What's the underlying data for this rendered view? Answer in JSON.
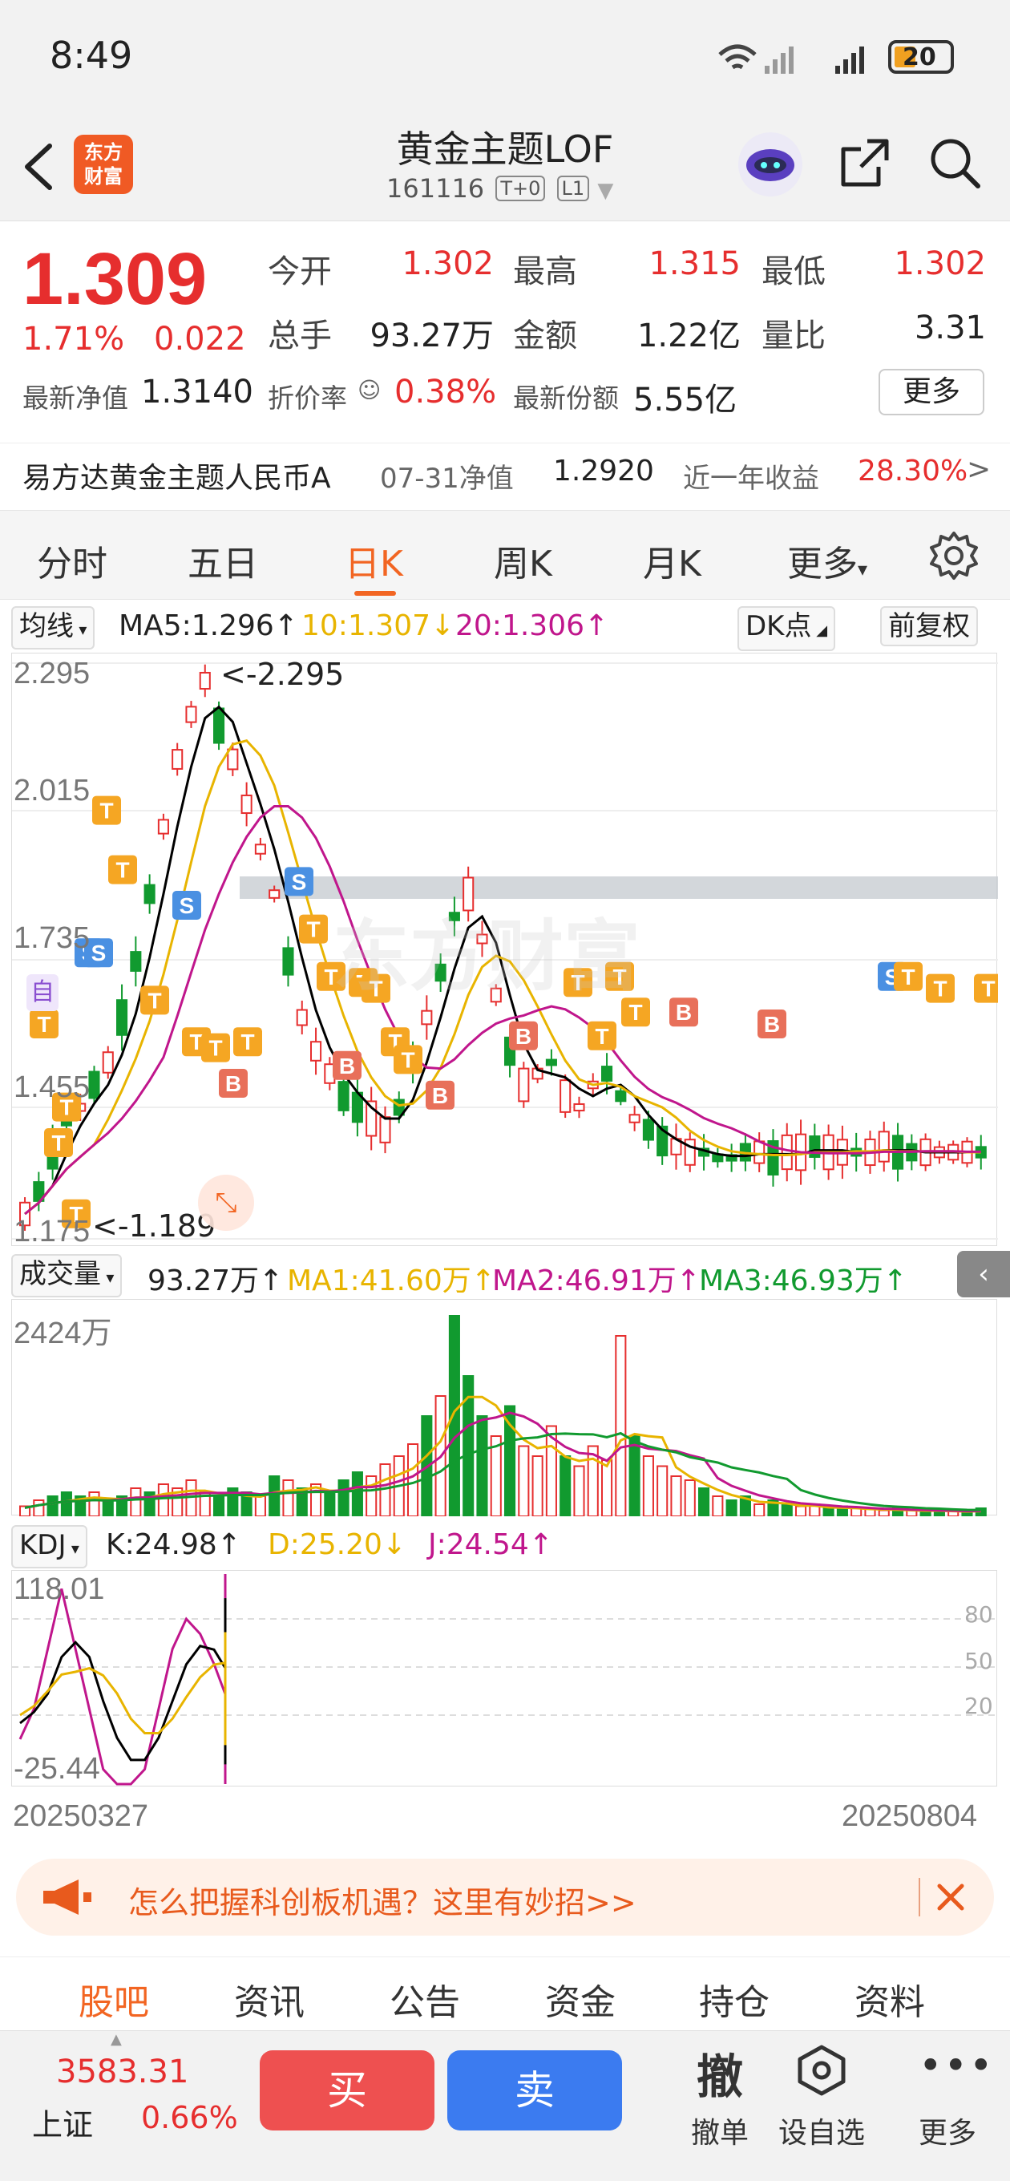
{
  "status_bar": {
    "time": "8:49",
    "battery": "20"
  },
  "header": {
    "logo_line1": "东方",
    "logo_line2": "财富",
    "title": "黄金主题LOF",
    "code": "161116",
    "tag1": "T+0",
    "tag2": "L1"
  },
  "quote": {
    "price": "1.309",
    "change_pct": "1.71%",
    "change": "0.022",
    "open_label": "今开",
    "open": "1.302",
    "high_label": "最高",
    "high": "1.315",
    "low_label": "最低",
    "low": "1.302",
    "volume_label": "总手",
    "volume": "93.27万",
    "amount_label": "金额",
    "amount": "1.22亿",
    "ratio_label": "量比",
    "ratio": "3.31",
    "nav_label": "最新净值",
    "nav": "1.3140",
    "discount_label": "折价率",
    "discount": "0.38%",
    "shares_label": "最新份额",
    "shares": "5.55亿",
    "more": "更多"
  },
  "fund_row": {
    "name": "易方达黄金主题人民币A",
    "nav_label": "07-31净值",
    "nav": "1.2920",
    "return_label": "近一年收益",
    "return": "28.30%"
  },
  "tabs": [
    "分时",
    "五日",
    "日K",
    "周K",
    "月K",
    "更多"
  ],
  "chart": {
    "indicator_select": "均线",
    "ma5": "MA5:1.296↑",
    "ma10": "10:1.307↓",
    "ma20": "20:1.306↑",
    "dk_button": "DK点",
    "adjust_button": "前复权",
    "y_labels": [
      "2.295",
      "2.015",
      "1.735",
      "1.455",
      "1.175"
    ],
    "high_marker": "<-2.295",
    "low_marker": "<-1.189",
    "watermark": "东方财富",
    "auto_tag": "自"
  },
  "volume": {
    "select": "成交量",
    "value": "93.27万↑",
    "ma1": "MA1:41.60万↑",
    "ma2": "MA2:46.91万↑",
    "ma3": "MA3:46.93万↑",
    "max_label": "2424万"
  },
  "kdj": {
    "select": "KDJ",
    "k": "K:24.98↑",
    "d": "D:25.20↓",
    "j": "J:24.54↑",
    "top_label": "118.01",
    "bottom_label": "-25.44",
    "level80": "80",
    "level50": "50",
    "level20": "20",
    "date_start": "20250327",
    "date_end": "20250804"
  },
  "ad": {
    "text": "怎么把握科创板机遇？这里有妙招>>"
  },
  "bottom_tabs": [
    "股吧",
    "资讯",
    "公告",
    "资金",
    "持仓",
    "资料"
  ],
  "footer": {
    "index_value": "3583.31",
    "index_name": "上证",
    "index_pct": "0.66%",
    "buy": "买",
    "sell": "卖",
    "withdraw_icon": "撤",
    "withdraw": "撤单",
    "watchlist": "设自选",
    "more": "更多"
  },
  "colors": {
    "up": "#e62e2e",
    "down": "#119a2f",
    "accent": "#f26522",
    "ma5": "#000000",
    "ma10": "#e8b400",
    "ma20": "#c0168c"
  }
}
